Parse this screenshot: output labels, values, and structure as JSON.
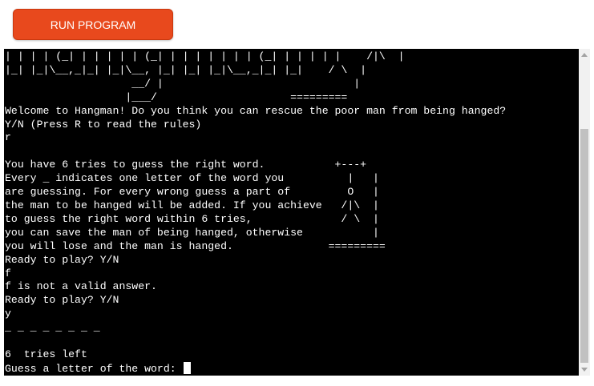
{
  "run_button": {
    "label": "RUN PROGRAM"
  },
  "terminal": {
    "lines": [
      "| | | | (_| | | | | | (_| | | | | | | | (_| | | | | |    /|\\  |",
      "|_| |_|\\__,_|_| |_|\\__, |_| |_| |_|\\__,_|_| |_|    / \\  |",
      "                    __/ |                              |",
      "                   |___/                     =========",
      "Welcome to Hangman! Do you think you can rescue the poor man from being hanged?",
      "Y/N (Press R to read the rules)",
      "r",
      "",
      "You have 6 tries to guess the right word.           +---+",
      "Every _ indicates one letter of the word you          |   |",
      "are guessing. For every wrong guess a part of         O   |",
      "the man to be hanged will be added. If you achieve   /|\\  |",
      "to guess the right word within 6 tries,              / \\  |",
      "you can save the man of being hanged, otherwise           |",
      "you will lose and the man is hanged.               =========",
      "Ready to play? Y/N",
      "f",
      "f is not a valid answer.",
      "Ready to play? Y/N",
      "y",
      "_ _ _ _ _ _ _ _",
      "",
      "6  tries left"
    ],
    "prompt": "Guess a letter of the word: "
  },
  "colors": {
    "button_bg": "#e8491d",
    "terminal_bg": "#000000",
    "terminal_fg": "#ffffff"
  }
}
